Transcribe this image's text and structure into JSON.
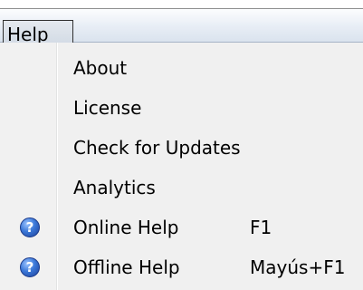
{
  "menubar": {
    "help_label": "Help"
  },
  "menu": {
    "items": [
      {
        "label": "About",
        "shortcut": "",
        "icon": ""
      },
      {
        "label": "License",
        "shortcut": "",
        "icon": ""
      },
      {
        "label": "Check for Updates",
        "shortcut": "",
        "icon": ""
      },
      {
        "label": "Analytics",
        "shortcut": "",
        "icon": ""
      },
      {
        "label": "Online Help",
        "shortcut": "F1",
        "icon": "help-icon"
      },
      {
        "label": "Offline Help",
        "shortcut": "Mayús+F1",
        "icon": "help-icon"
      }
    ],
    "help_icon_glyph": "?"
  },
  "colors": {
    "menu_background": "#f0f0f0",
    "menubar_gradient_top": "#fcfdfe",
    "menubar_gradient_bottom": "#dae3ee",
    "help_icon_blue": "#3b78d8"
  }
}
